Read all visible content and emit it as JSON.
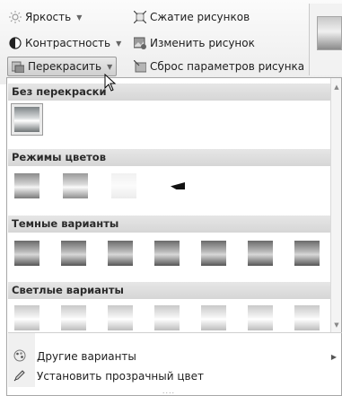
{
  "ribbon": {
    "brightness_label": "Яркость",
    "contrast_label": "Контрастность",
    "recolor_label": "Перекрасить",
    "compress_label": "Сжатие рисунков",
    "change_label": "Изменить рисунок",
    "reset_label": "Сброс параметров рисунка"
  },
  "gallery": {
    "sections": [
      {
        "title": "Без перекраски",
        "tiles": [
          "orig"
        ]
      },
      {
        "title": "Режимы цветов",
        "tiles": [
          "gray",
          "sepia",
          "washout",
          "bw"
        ]
      },
      {
        "title": "Темные варианты",
        "tiles": [
          "dark",
          "dark",
          "dark",
          "dark",
          "dark",
          "dark",
          "dark"
        ]
      },
      {
        "title": "Светлые варианты",
        "tiles": [
          "light",
          "light",
          "light",
          "light",
          "light",
          "light",
          "light"
        ]
      }
    ]
  },
  "menu": {
    "more_variants": "Другие варианты",
    "set_transparent": "Установить прозрачный цвет"
  },
  "grip": "....",
  "colors": {
    "accent": "#f5c65a",
    "header_bg": "#dcdcdc"
  }
}
